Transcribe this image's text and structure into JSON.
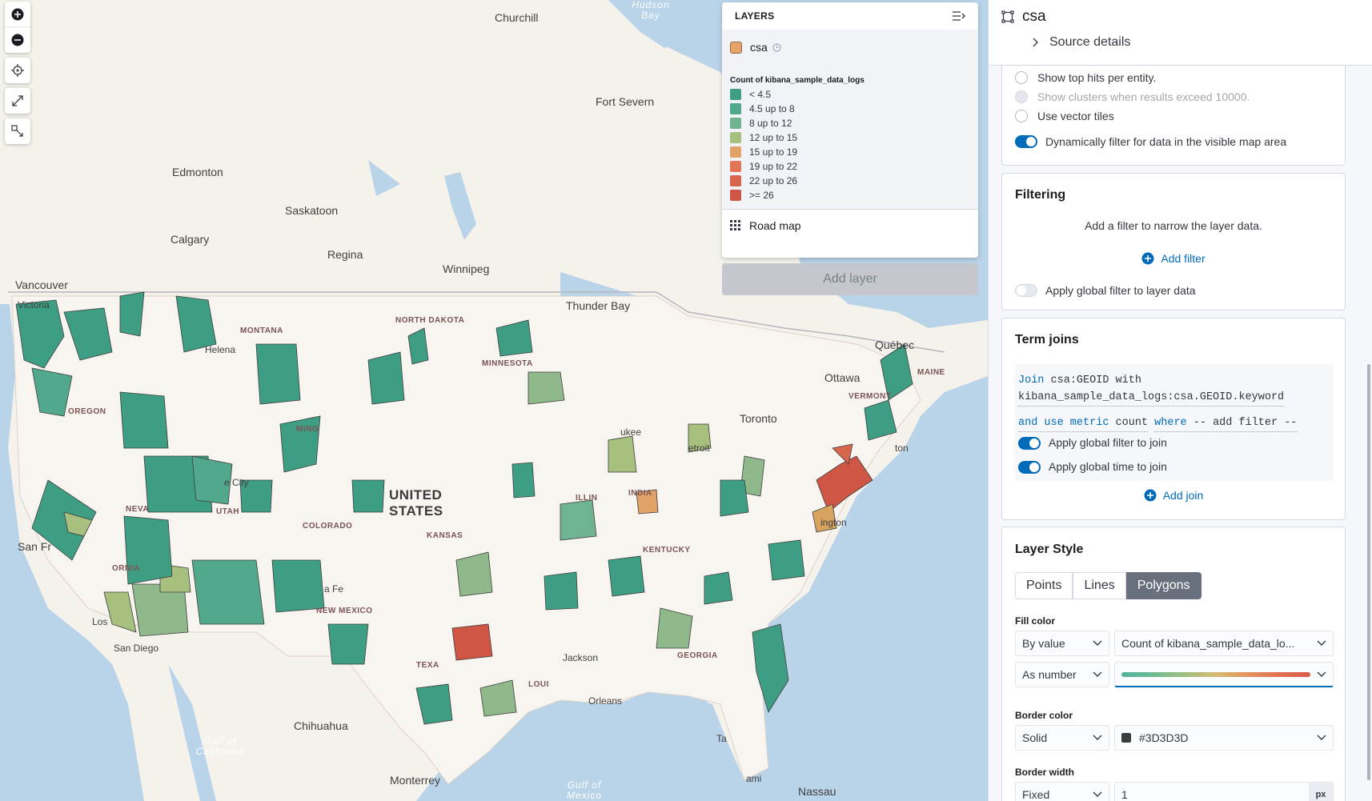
{
  "map": {
    "places": {
      "churchill": "Churchill",
      "fort_severn": "Fort Severn",
      "edmonton": "Edmonton",
      "saskatoon": "Saskatoon",
      "calgary": "Calgary",
      "regina": "Regina",
      "winnipeg": "Winnipeg",
      "vancouver": "Vancouver",
      "victoria": "Victoria",
      "thunder_bay": "Thunder Bay",
      "quebec": "Québec",
      "ottawa": "Ottawa",
      "toronto": "Toronto",
      "san_francisco": "San Fr",
      "chihuahua": "Chihuahua",
      "monterrey": "Monterrey",
      "nassau": "Nassau",
      "helena": "Helena",
      "salt_lake_city": "e City",
      "santa_fe": "a Fe",
      "los_angeles": "Los",
      "san_diego": "San Diego",
      "detroit": "etroit",
      "milwaukee": "ukee",
      "boston": "ton",
      "washington": "ington",
      "orleans": "Orleans",
      "jackson": "Jackson",
      "tampa": "Ta",
      "miami": "ami"
    },
    "states": {
      "montana": "MONTANA",
      "north_dakota": "NORTH DAKOTA",
      "minnesota": "MINNESOTA",
      "oregon": "OREGON",
      "wyoming": "MING",
      "nevada": "NEVA",
      "utah": "UTAH",
      "colorado": "COLORADO",
      "kansas": "KANSAS",
      "illinois": "ILLIN",
      "indiana": "INDIA",
      "kentucky": "KENTUCKY",
      "new_mexico": "NEW MEXICO",
      "texas": "TEXA",
      "georgia": "GEORGIA",
      "louisiana": "LOUI",
      "california": "ORNIA",
      "vermont": "VERMONT",
      "maine": "MAINE"
    },
    "country": "UNITED STATES",
    "water": {
      "hudson_bay": "Hudson Bay",
      "gulf_california": "Gulf of California",
      "gulf_mexico": "Gulf of Mexico"
    }
  },
  "map_controls": {
    "zoom_in_icon": "plus-circle-icon",
    "zoom_out_icon": "minus-circle-icon",
    "locate_icon": "crosshair-icon",
    "fullscreen_icon": "expand-icon",
    "tools_icon": "draw-tools-icon"
  },
  "layers_panel": {
    "title": "LAYERS",
    "layer_name": "csa",
    "legend_title": "Count of kibana_sample_data_logs",
    "legend": [
      {
        "label": "< 4.5",
        "color": "#3e9e84"
      },
      {
        "label": "4.5 up to 8",
        "color": "#52a88c"
      },
      {
        "label": "8 up to 12",
        "color": "#6fb391"
      },
      {
        "label": "12 up to 15",
        "color": "#a7c07e"
      },
      {
        "label": "15 up to 19",
        "color": "#e0a266"
      },
      {
        "label": "19 up to 22",
        "color": "#e07558"
      },
      {
        "label": "22 up to 26",
        "color": "#d8664f"
      },
      {
        "label": ">= 26",
        "color": "#cf5545"
      }
    ],
    "road_map": "Road map",
    "add_layer": "Add layer"
  },
  "panel": {
    "title": "csa",
    "source_details": "Source details",
    "options": {
      "top_hits": "Show top hits per entity.",
      "clusters": "Show clusters when results exceed 10000.",
      "vector_tiles": "Use vector tiles",
      "dynamic_filter": "Dynamically filter for data in the visible map area"
    },
    "filtering": {
      "title": "Filtering",
      "description": "Add a filter to narrow the layer data.",
      "add_filter": "Add filter",
      "global_filter": "Apply global filter to layer data"
    },
    "term_joins": {
      "title": "Term joins",
      "join_kw": "Join",
      "join_left": "csa:GEOID",
      "with_kw": "with",
      "join_right": "kibana_sample_data_logs:csa.GEOID.keyword",
      "and_use_metric": "and use metric",
      "metric": "count",
      "where_kw": "where",
      "filter": "-- add filter --",
      "global_filter": "Apply global filter to join",
      "global_time": "Apply global time to join",
      "add_join": "Add join"
    },
    "layer_style": {
      "title": "Layer Style",
      "tabs": [
        "Points",
        "Lines",
        "Polygons"
      ],
      "fill_color_label": "Fill color",
      "fill_mode": "By value",
      "fill_field": "Count of kibana_sample_data_lo...",
      "fill_as": "As number",
      "border_color_label": "Border color",
      "border_mode": "Solid",
      "border_color": "#3D3D3D",
      "border_width_label": "Border width",
      "border_width_mode": "Fixed",
      "border_width_value": "1",
      "border_width_unit": "px"
    }
  },
  "colors": {
    "accent": "#006bb8",
    "land": "#f6f3ee",
    "water": "#b9d3e8",
    "ramp_start": "#54b399",
    "ramp_end": "#d85b4b"
  }
}
